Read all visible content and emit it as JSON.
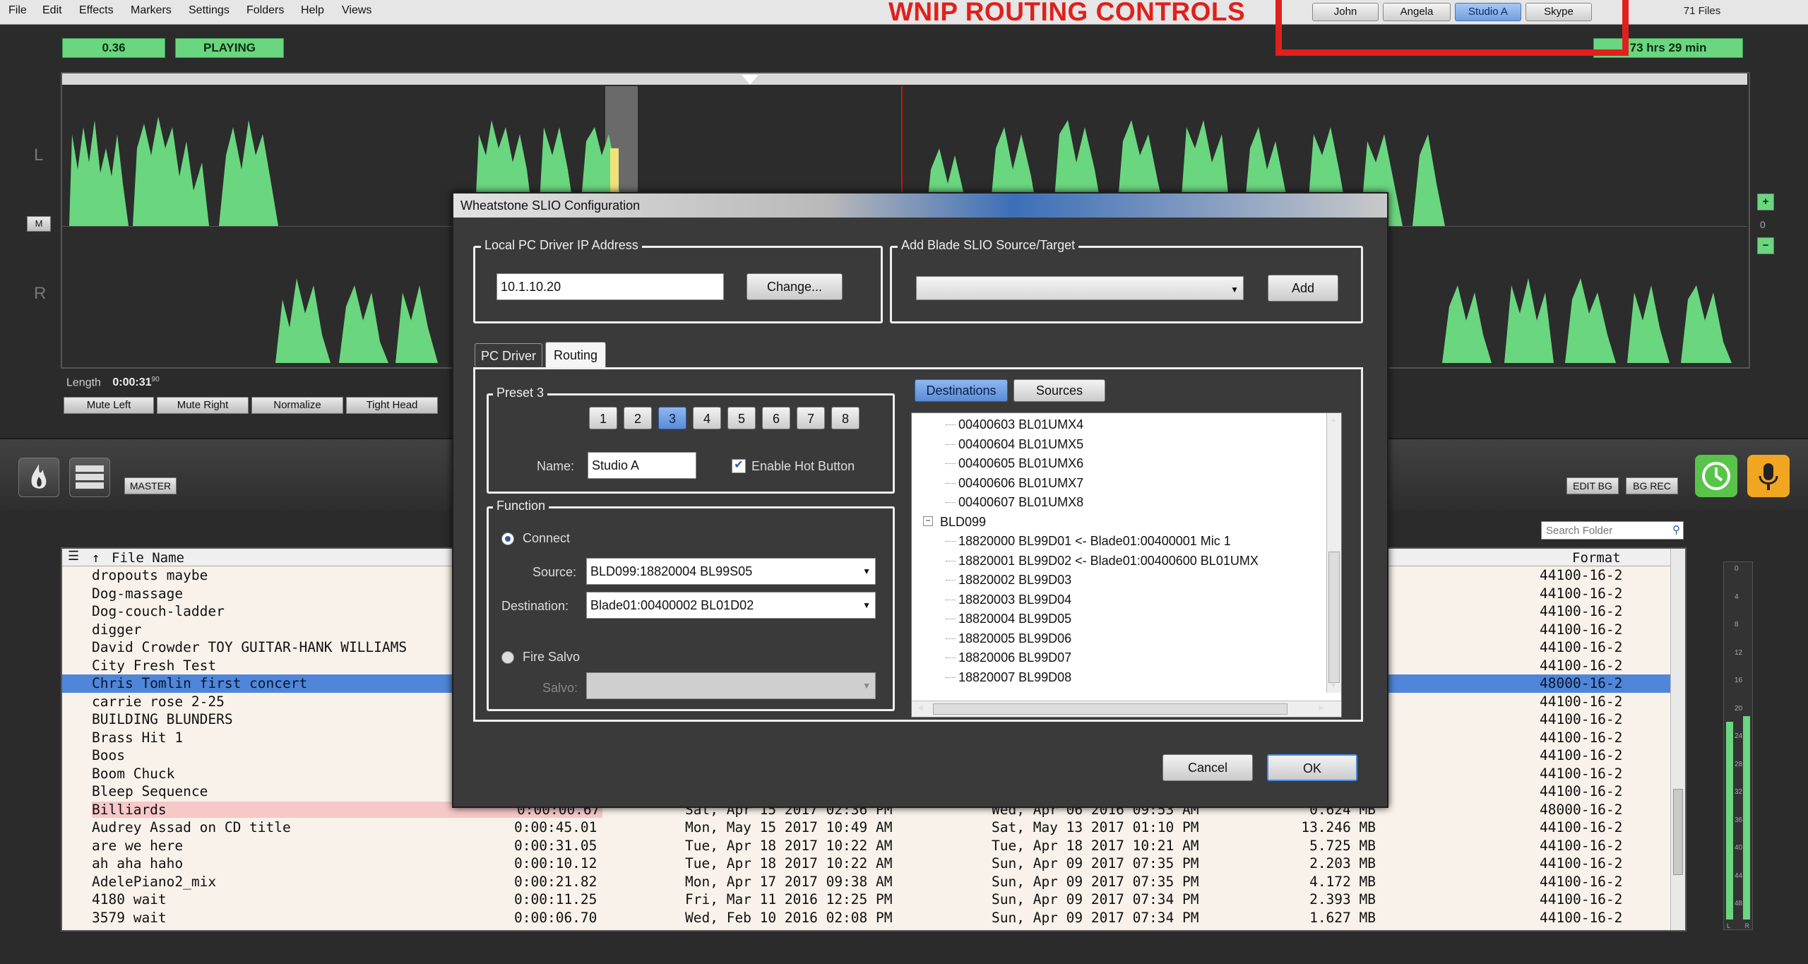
{
  "menu": [
    "File",
    "Edit",
    "Effects",
    "Markers",
    "Settings",
    "Folders",
    "Help",
    "Views"
  ],
  "annotation": "WNIP ROUTING CONTROLS",
  "hot_buttons": [
    {
      "label": "John",
      "active": false
    },
    {
      "label": "Angela",
      "active": false
    },
    {
      "label": "Studio A",
      "active": true
    },
    {
      "label": "Skype",
      "active": false
    }
  ],
  "files_count": "71 Files",
  "status": {
    "level": "0.36",
    "state": "PLAYING",
    "time_left": "73 hrs  29 min"
  },
  "channels": {
    "left": "L",
    "right": "R",
    "mono_button": "M"
  },
  "zoom": {
    "plus": "+",
    "zero": "0",
    "minus": "−"
  },
  "length": {
    "label": "Length",
    "value": "0:00:31",
    "frac": "90"
  },
  "edit_buttons": [
    "Mute Left",
    "Mute Right",
    "Normalize",
    "Tight Head"
  ],
  "toolbar": {
    "master": "MASTER",
    "edit_bg": "EDIT BG",
    "bg_rec": "BG REC"
  },
  "search": {
    "placeholder": "Search Folder"
  },
  "filelist": {
    "col_name": "File Name",
    "sort_marker": "↑",
    "col_format": "Format",
    "rows": [
      {
        "name": "dropouts maybe",
        "length": "",
        "date1": "",
        "date2": "",
        "size": "",
        "format": "44100-16-2"
      },
      {
        "name": "Dog-massage",
        "length": "",
        "date1": "",
        "date2": "",
        "size": "",
        "format": "44100-16-2"
      },
      {
        "name": "Dog-couch-ladder",
        "length": "",
        "date1": "",
        "date2": "",
        "size": "",
        "format": "44100-16-2"
      },
      {
        "name": "digger",
        "length": "",
        "date1": "",
        "date2": "",
        "size": "",
        "format": "44100-16-2"
      },
      {
        "name": "David Crowder TOY GUITAR-HANK WILLIAMS",
        "length": "",
        "date1": "",
        "date2": "",
        "size": "",
        "format": "44100-16-2"
      },
      {
        "name": "City Fresh Test",
        "length": "",
        "date1": "",
        "date2": "",
        "size": "",
        "format": "44100-16-2"
      },
      {
        "name": "Chris Tomlin first concert",
        "length": "",
        "date1": "",
        "date2": "",
        "size": "",
        "format": "48000-16-2"
      },
      {
        "name": "carrie rose 2-25",
        "length": "",
        "date1": "",
        "date2": "",
        "size": "",
        "format": "44100-16-2"
      },
      {
        "name": "BUILDING BLUNDERS",
        "length": "",
        "date1": "",
        "date2": "",
        "size": "",
        "format": "44100-16-2"
      },
      {
        "name": "Brass Hit 1",
        "length": "",
        "date1": "",
        "date2": "",
        "size": "",
        "format": "44100-16-2"
      },
      {
        "name": "Boos",
        "length": "",
        "date1": "",
        "date2": "",
        "size": "",
        "format": "44100-16-2"
      },
      {
        "name": "Boom Chuck",
        "length": "",
        "date1": "",
        "date2": "",
        "size": "",
        "format": "44100-16-2"
      },
      {
        "name": "Bleep Sequence",
        "length": "",
        "date1": "",
        "date2": "",
        "size": "",
        "format": "44100-16-2"
      },
      {
        "name": "Billiards",
        "length": "0:00:00.67",
        "date1": "Sat, Apr 15 2017   02:36 PM",
        "date2": "Wed, Apr 06 2016   09:53 AM",
        "size": "0.624 MB",
        "format": "48000-16-2"
      },
      {
        "name": "Audrey Assad on CD title",
        "length": "0:00:45.01",
        "date1": "Mon, May 15 2017   10:49 AM",
        "date2": "Sat, May 13 2017   01:10 PM",
        "size": "13.246 MB",
        "format": "44100-16-2"
      },
      {
        "name": "are we here",
        "length": "0:00:31.05",
        "date1": "Tue, Apr 18 2017   10:22 AM",
        "date2": "Tue, Apr 18 2017   10:21 AM",
        "size": "5.725 MB",
        "format": "44100-16-2"
      },
      {
        "name": "ah aha haho",
        "length": "0:00:10.12",
        "date1": "Tue, Apr 18 2017   10:22 AM",
        "date2": "Sun, Apr 09 2017   07:35 PM",
        "size": "2.203 MB",
        "format": "44100-16-2"
      },
      {
        "name": "AdelePiano2_mix",
        "length": "0:00:21.82",
        "date1": "Mon, Apr 17 2017   09:38 AM",
        "date2": "Sun, Apr 09 2017   07:35 PM",
        "size": "4.172 MB",
        "format": "44100-16-2"
      },
      {
        "name": "4180 wait",
        "length": "0:00:11.25",
        "date1": "Fri, Mar 11 2016   12:25 PM",
        "date2": "Sun, Apr 09 2017   07:34 PM",
        "size": "2.393 MB",
        "format": "44100-16-2"
      },
      {
        "name": "3579 wait",
        "length": "0:00:06.70",
        "date1": "Wed, Feb 10 2016   02:08 PM",
        "date2": "Sun, Apr 09 2017   07:34 PM",
        "size": "1.627 MB",
        "format": "44100-16-2"
      }
    ]
  },
  "meter": {
    "scale": [
      "0",
      "4",
      "8",
      "12",
      "16",
      "20",
      "24",
      "28",
      "32",
      "36",
      "40",
      "44",
      "48"
    ],
    "left": "L",
    "right": "R",
    "level_left": 0.55,
    "level_right": 0.56
  },
  "dialog": {
    "title": "Wheatstone SLIO Configuration",
    "ip_group": "Local PC Driver IP Address",
    "ip_value": "10.1.10.20",
    "change_button": "Change...",
    "add_group": "Add Blade SLIO Source/Target",
    "add_button": "Add",
    "tabs": [
      "PC Driver",
      "Routing"
    ],
    "preset_group": "Preset 3",
    "presets": [
      "1",
      "2",
      "3",
      "4",
      "5",
      "6",
      "7",
      "8"
    ],
    "active_preset": 2,
    "name_label": "Name:",
    "name_value": "Studio A",
    "hot_button_label": "Enable Hot Button",
    "function_group": "Function",
    "connect_label": "Connect",
    "source_label": "Source:",
    "source_value": "BLD099:18820004  BL99S05",
    "destination_label": "Destination:",
    "destination_value": "Blade01:00400002  BL01D02",
    "fire_salvo_label": "Fire Salvo",
    "salvo_label": "Salvo:",
    "dest_tab": "Destinations",
    "sources_tab": "Sources",
    "tree": [
      "00400603  BL01UMX4",
      "00400604  BL01UMX5",
      "00400605  BL01UMX6",
      "00400606  BL01UMX7",
      "00400607  BL01UMX8",
      "BLD099",
      "18820000  BL99D01 <- Blade01:00400001  Mic 1",
      "18820001  BL99D02 <- Blade01:00400600  BL01UMX",
      "18820002  BL99D03",
      "18820003  BL99D04",
      "18820004  BL99D05",
      "18820005  BL99D06",
      "18820006  BL99D07",
      "18820007  BL99D08"
    ],
    "cancel": "Cancel",
    "ok": "OK"
  },
  "colors": {
    "accent": "#4f86d9",
    "waveform": "#6ad67f",
    "annotation": "#e0201c",
    "selected_row": "#4f86d9",
    "pink_row": "#f6c8c8"
  }
}
